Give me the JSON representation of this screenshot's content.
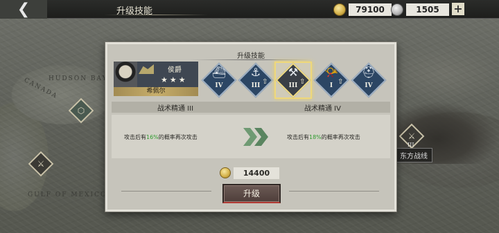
{
  "topbar": {
    "back_icon": "chevron-left-icon",
    "title": "升级技能",
    "gold": "79100",
    "silver": "1505",
    "plus_label": "+"
  },
  "map": {
    "labels": [
      "CANADA",
      "HUDSON BAY",
      "GULF OF MEXICO"
    ],
    "front_label": "东方战线",
    "front_level": "III"
  },
  "dialog": {
    "title": "升级技能",
    "officer": {
      "rank": "侯爵",
      "stars": "★★★",
      "name": "希佩尔"
    },
    "skills": [
      {
        "icon": "battleship-icon",
        "level": "IV",
        "upgradable": false,
        "selected": false
      },
      {
        "icon": "anchor-icon",
        "level": "III",
        "upgradable": true,
        "selected": false
      },
      {
        "icon": "tools-icon",
        "level": "III",
        "upgradable": true,
        "selected": true
      },
      {
        "icon": "bugle-icon",
        "level": "I",
        "upgradable": true,
        "selected": false
      },
      {
        "icon": "helmet-icon",
        "level": "IV",
        "upgradable": false,
        "selected": false
      }
    ],
    "current_skill": "战术精通 III",
    "next_skill": "战术精通 IV",
    "current_desc_pre": "攻击后有",
    "current_pct": "16%",
    "current_desc_post": "的概率再次攻击",
    "next_desc_pre": "攻击后有",
    "next_pct": "18%",
    "next_desc_post": "的概率再次攻击",
    "cost": "14400",
    "upgrade_label": "升级",
    "colors": {
      "accent_green": "#2f9c2f",
      "highlight": "#efd87a"
    }
  }
}
